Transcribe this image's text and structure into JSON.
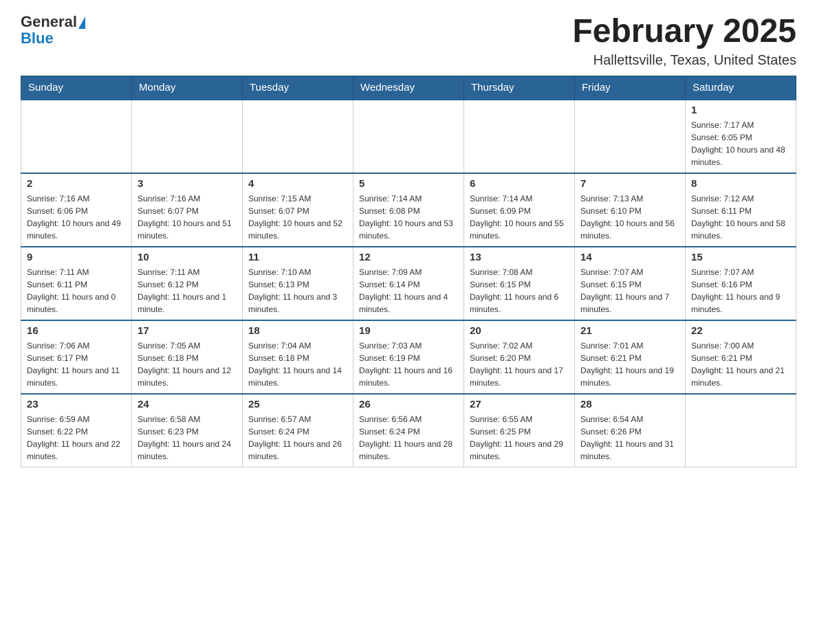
{
  "header": {
    "logo": {
      "general": "General",
      "blue": "Blue"
    },
    "title": "February 2025",
    "location": "Hallettsville, Texas, United States"
  },
  "days_of_week": [
    "Sunday",
    "Monday",
    "Tuesday",
    "Wednesday",
    "Thursday",
    "Friday",
    "Saturday"
  ],
  "weeks": [
    [
      {
        "day": "",
        "info": ""
      },
      {
        "day": "",
        "info": ""
      },
      {
        "day": "",
        "info": ""
      },
      {
        "day": "",
        "info": ""
      },
      {
        "day": "",
        "info": ""
      },
      {
        "day": "",
        "info": ""
      },
      {
        "day": "1",
        "info": "Sunrise: 7:17 AM\nSunset: 6:05 PM\nDaylight: 10 hours and 48 minutes."
      }
    ],
    [
      {
        "day": "2",
        "info": "Sunrise: 7:16 AM\nSunset: 6:06 PM\nDaylight: 10 hours and 49 minutes."
      },
      {
        "day": "3",
        "info": "Sunrise: 7:16 AM\nSunset: 6:07 PM\nDaylight: 10 hours and 51 minutes."
      },
      {
        "day": "4",
        "info": "Sunrise: 7:15 AM\nSunset: 6:07 PM\nDaylight: 10 hours and 52 minutes."
      },
      {
        "day": "5",
        "info": "Sunrise: 7:14 AM\nSunset: 6:08 PM\nDaylight: 10 hours and 53 minutes."
      },
      {
        "day": "6",
        "info": "Sunrise: 7:14 AM\nSunset: 6:09 PM\nDaylight: 10 hours and 55 minutes."
      },
      {
        "day": "7",
        "info": "Sunrise: 7:13 AM\nSunset: 6:10 PM\nDaylight: 10 hours and 56 minutes."
      },
      {
        "day": "8",
        "info": "Sunrise: 7:12 AM\nSunset: 6:11 PM\nDaylight: 10 hours and 58 minutes."
      }
    ],
    [
      {
        "day": "9",
        "info": "Sunrise: 7:11 AM\nSunset: 6:11 PM\nDaylight: 11 hours and 0 minutes."
      },
      {
        "day": "10",
        "info": "Sunrise: 7:11 AM\nSunset: 6:12 PM\nDaylight: 11 hours and 1 minute."
      },
      {
        "day": "11",
        "info": "Sunrise: 7:10 AM\nSunset: 6:13 PM\nDaylight: 11 hours and 3 minutes."
      },
      {
        "day": "12",
        "info": "Sunrise: 7:09 AM\nSunset: 6:14 PM\nDaylight: 11 hours and 4 minutes."
      },
      {
        "day": "13",
        "info": "Sunrise: 7:08 AM\nSunset: 6:15 PM\nDaylight: 11 hours and 6 minutes."
      },
      {
        "day": "14",
        "info": "Sunrise: 7:07 AM\nSunset: 6:15 PM\nDaylight: 11 hours and 7 minutes."
      },
      {
        "day": "15",
        "info": "Sunrise: 7:07 AM\nSunset: 6:16 PM\nDaylight: 11 hours and 9 minutes."
      }
    ],
    [
      {
        "day": "16",
        "info": "Sunrise: 7:06 AM\nSunset: 6:17 PM\nDaylight: 11 hours and 11 minutes."
      },
      {
        "day": "17",
        "info": "Sunrise: 7:05 AM\nSunset: 6:18 PM\nDaylight: 11 hours and 12 minutes."
      },
      {
        "day": "18",
        "info": "Sunrise: 7:04 AM\nSunset: 6:18 PM\nDaylight: 11 hours and 14 minutes."
      },
      {
        "day": "19",
        "info": "Sunrise: 7:03 AM\nSunset: 6:19 PM\nDaylight: 11 hours and 16 minutes."
      },
      {
        "day": "20",
        "info": "Sunrise: 7:02 AM\nSunset: 6:20 PM\nDaylight: 11 hours and 17 minutes."
      },
      {
        "day": "21",
        "info": "Sunrise: 7:01 AM\nSunset: 6:21 PM\nDaylight: 11 hours and 19 minutes."
      },
      {
        "day": "22",
        "info": "Sunrise: 7:00 AM\nSunset: 6:21 PM\nDaylight: 11 hours and 21 minutes."
      }
    ],
    [
      {
        "day": "23",
        "info": "Sunrise: 6:59 AM\nSunset: 6:22 PM\nDaylight: 11 hours and 22 minutes."
      },
      {
        "day": "24",
        "info": "Sunrise: 6:58 AM\nSunset: 6:23 PM\nDaylight: 11 hours and 24 minutes."
      },
      {
        "day": "25",
        "info": "Sunrise: 6:57 AM\nSunset: 6:24 PM\nDaylight: 11 hours and 26 minutes."
      },
      {
        "day": "26",
        "info": "Sunrise: 6:56 AM\nSunset: 6:24 PM\nDaylight: 11 hours and 28 minutes."
      },
      {
        "day": "27",
        "info": "Sunrise: 6:55 AM\nSunset: 6:25 PM\nDaylight: 11 hours and 29 minutes."
      },
      {
        "day": "28",
        "info": "Sunrise: 6:54 AM\nSunset: 6:26 PM\nDaylight: 11 hours and 31 minutes."
      },
      {
        "day": "",
        "info": ""
      }
    ]
  ]
}
